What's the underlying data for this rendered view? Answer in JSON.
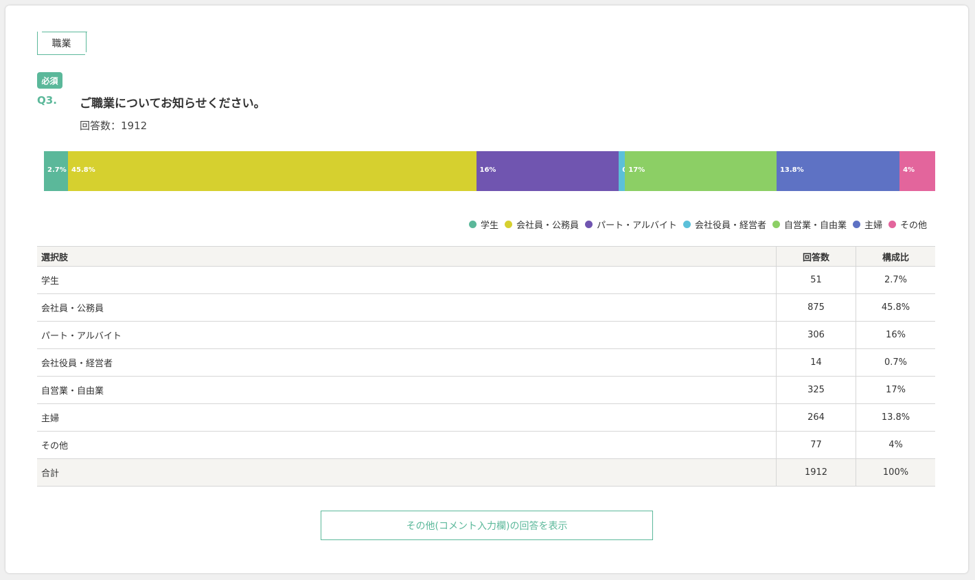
{
  "section_tab": "職業",
  "required_badge": "必須",
  "question": {
    "number": "Q3.",
    "text": "ご職業についてお知らせください。",
    "response_count_label": "回答数：1912"
  },
  "colors": {
    "accent": "#5bb89a",
    "series": [
      "#5bb89a",
      "#d6d02f",
      "#7055b0",
      "#5bc0d9",
      "#8ccf65",
      "#5e72c4",
      "#e3659c"
    ]
  },
  "chart_data": {
    "type": "bar",
    "orientation": "horizontal-stacked-100",
    "categories": [
      "学生",
      "会社員・公務員",
      "パート・アルバイト",
      "会社役員・経営者",
      "自営業・自由業",
      "主婦",
      "その他"
    ],
    "values": [
      2.7,
      45.8,
      16,
      0.7,
      17,
      13.8,
      4
    ],
    "labels": [
      "2.7%",
      "45.8%",
      "16%",
      "0.7%",
      "17%",
      "13.8%",
      "4%"
    ],
    "legend_position": "bottom-right",
    "title": "",
    "xlabel": "",
    "ylabel": ""
  },
  "table": {
    "headers": [
      "選択肢",
      "回答数",
      "構成比"
    ],
    "rows": [
      [
        "学生",
        "51",
        "2.7%"
      ],
      [
        "会社員・公務員",
        "875",
        "45.8%"
      ],
      [
        "パート・アルバイト",
        "306",
        "16%"
      ],
      [
        "会社役員・経営者",
        "14",
        "0.7%"
      ],
      [
        "自営業・自由業",
        "325",
        "17%"
      ],
      [
        "主婦",
        "264",
        "13.8%"
      ],
      [
        "その他",
        "77",
        "4%"
      ]
    ],
    "total": [
      "合計",
      "1912",
      "100%"
    ]
  },
  "more_button_label": "その他(コメント入力欄)の回答を表示"
}
